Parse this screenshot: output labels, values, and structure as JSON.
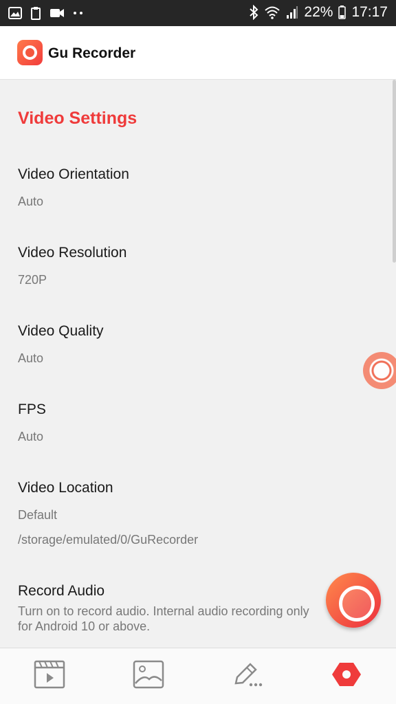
{
  "status_bar": {
    "battery": "22%",
    "time": "17:17",
    "icons": [
      "image-icon",
      "clipboard-icon",
      "video-camera-icon",
      "more-dots-icon",
      "bluetooth-icon",
      "wifi-icon",
      "signal-icon",
      "battery-icon"
    ]
  },
  "app": {
    "title": "Gu Recorder",
    "logo_icon": "gu-recorder-logo-icon"
  },
  "section": {
    "title": "Video Settings"
  },
  "settings": {
    "orientation": {
      "title": "Video Orientation",
      "value": "Auto"
    },
    "resolution": {
      "title": "Video Resolution",
      "value": "720P"
    },
    "quality": {
      "title": "Video Quality",
      "value": "Auto"
    },
    "fps": {
      "title": "FPS",
      "value": "Auto"
    },
    "location": {
      "title": "Video Location",
      "value": "Default",
      "path": "/storage/emulated/0/GuRecorder"
    },
    "audio": {
      "title": "Record Audio",
      "desc": "Turn on to record audio. Internal audio recording only for Android 10 or above."
    }
  },
  "bottom_nav": {
    "items": [
      "video-list-icon",
      "gallery-icon",
      "edit-icon",
      "settings-icon"
    ],
    "active_color": "#ef3b3b"
  },
  "colors": {
    "accent": "#ef3b3b",
    "background": "#f1f1f1"
  }
}
